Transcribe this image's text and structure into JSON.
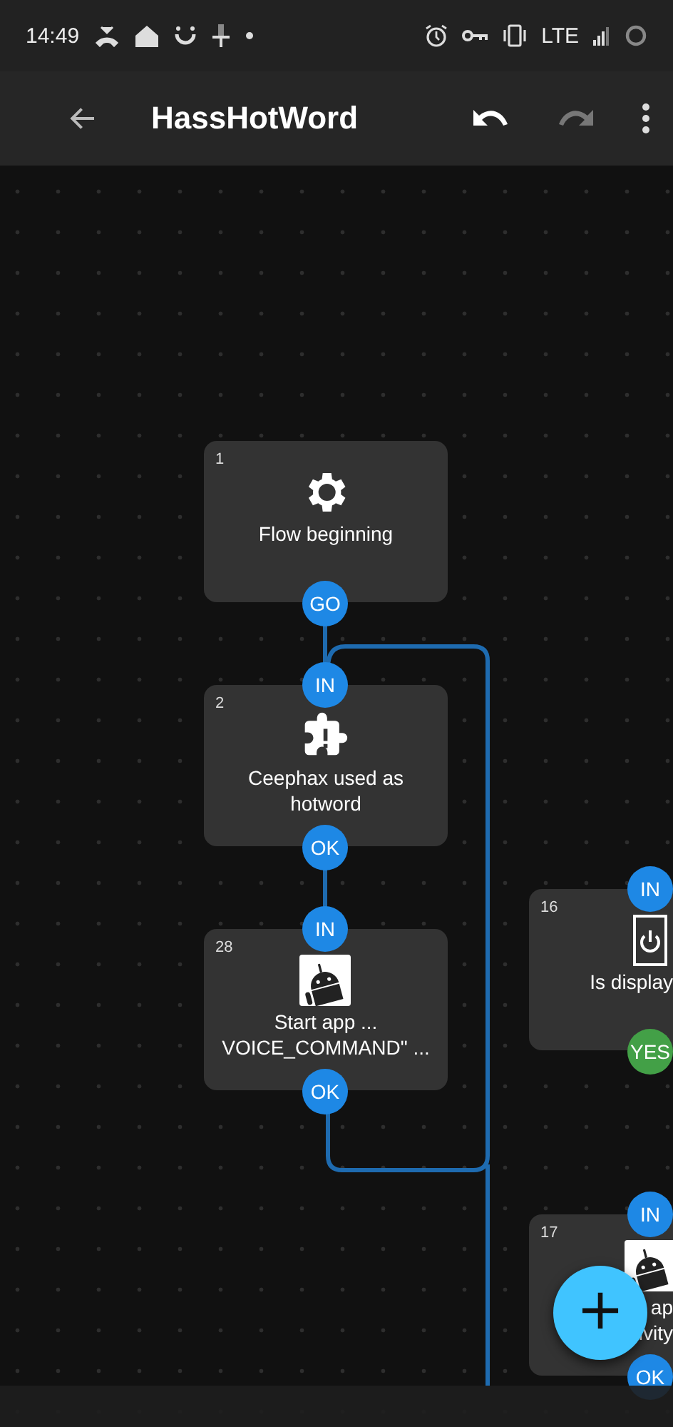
{
  "status_bar": {
    "time": "14:49",
    "network": "LTE"
  },
  "toolbar": {
    "title": "HassHotWord",
    "undo_disabled": false,
    "redo_disabled": true
  },
  "nodes": [
    {
      "number": "1",
      "lines": [
        "Flow beginning"
      ],
      "ports": [
        {
          "label": "GO",
          "kind": "out"
        }
      ]
    },
    {
      "number": "2",
      "lines": [
        "Ceephax used as",
        "hotword"
      ],
      "ports": [
        {
          "label": "IN",
          "kind": "in"
        },
        {
          "label": "OK",
          "kind": "out"
        }
      ]
    },
    {
      "number": "28",
      "lines": [
        "Start app ...",
        "VOICE_COMMAND\" ..."
      ],
      "ports": [
        {
          "label": "IN",
          "kind": "in"
        },
        {
          "label": "OK",
          "kind": "out"
        }
      ]
    },
    {
      "number": "16",
      "lines": [
        "Is display"
      ],
      "ports": [
        {
          "label": "IN",
          "kind": "in"
        },
        {
          "label": "YES",
          "kind": "yes"
        }
      ]
    },
    {
      "number": "17",
      "lines": [
        "ap",
        "ivity"
      ],
      "ports": [
        {
          "label": "IN",
          "kind": "in"
        },
        {
          "label": "OK",
          "kind": "out"
        }
      ]
    }
  ],
  "fab": {
    "label": "+"
  }
}
